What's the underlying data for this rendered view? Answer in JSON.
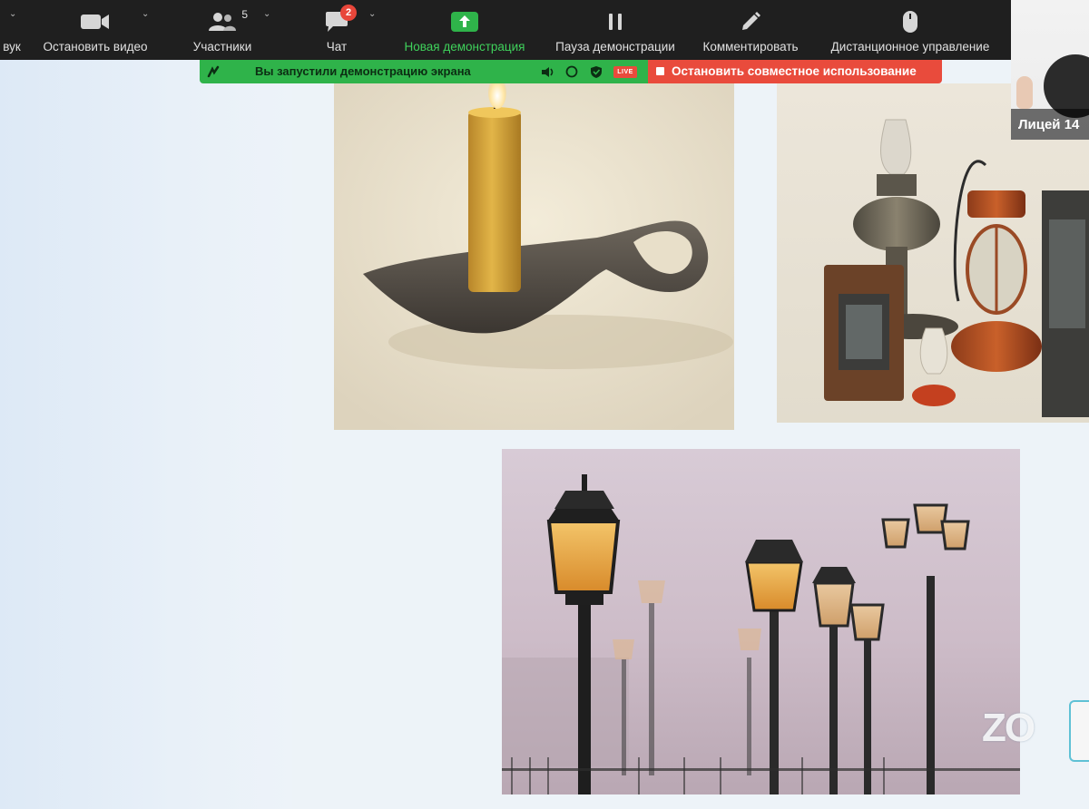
{
  "toolbar": {
    "items": [
      {
        "label": "вук",
        "icon": "audio-icon"
      },
      {
        "label": "Остановить видео",
        "icon": "video-camera-icon"
      },
      {
        "label": "Участники",
        "icon": "participants-icon",
        "count": "5"
      },
      {
        "label": "Чат",
        "icon": "chat-icon",
        "badge": "2"
      },
      {
        "label": "Новая демонстрация",
        "icon": "share-screen-icon"
      },
      {
        "label": "Пауза демонстрации",
        "icon": "pause-icon"
      },
      {
        "label": "Комментировать",
        "icon": "pencil-icon"
      },
      {
        "label": "Дистанционное управление",
        "icon": "mouse-icon"
      }
    ]
  },
  "share_banner": {
    "message": "Вы запустили демонстрацию экрана",
    "live_label": "LIVE",
    "stop_label": "Остановить совместное использование"
  },
  "participant": {
    "name": "Лицей 14"
  },
  "watermark": {
    "text": "ZO"
  },
  "colors": {
    "toolbar_bg": "#1f1f1f",
    "share_green": "#2fb34a",
    "stop_red": "#e94b3c",
    "accent_green_text": "#3fd15b"
  },
  "images": [
    {
      "subject": "candle-in-holder"
    },
    {
      "subject": "antique-oil-lamps"
    },
    {
      "subject": "street-lamps-in-fog"
    }
  ]
}
